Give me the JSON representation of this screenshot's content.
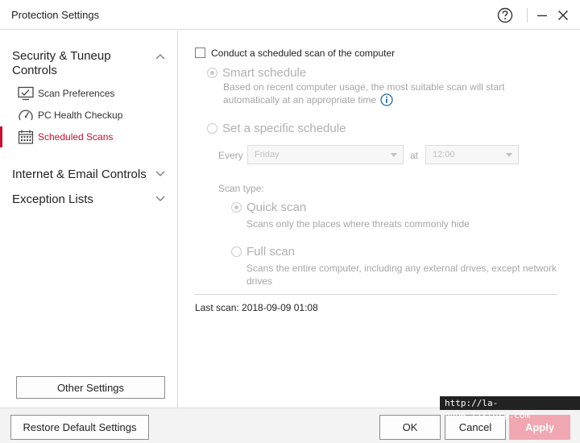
{
  "window": {
    "title": "Protection Settings"
  },
  "sidebar": {
    "sections": [
      {
        "label_line1": "Security & Tuneup",
        "label_line2": "Controls",
        "expanded": true
      },
      {
        "label": "Internet & Email Controls",
        "expanded": false
      },
      {
        "label": "Exception Lists",
        "expanded": false
      }
    ],
    "items": [
      {
        "label": "Scan Preferences",
        "icon": "monitor-check-icon"
      },
      {
        "label": "PC Health Checkup",
        "icon": "gauge-icon"
      },
      {
        "label": "Scheduled Scans",
        "icon": "calendar-icon",
        "active": true
      }
    ],
    "other_settings": "Other Settings"
  },
  "main": {
    "scheduled_scan_checkbox": "Conduct a scheduled scan of the computer",
    "smart_schedule": {
      "title": "Smart schedule",
      "desc_line1": "Based on recent computer usage, the most suitable scan will start",
      "desc_line2": "automatically at an appropriate time"
    },
    "specific_schedule": {
      "title": "Set a specific schedule"
    },
    "every_label": "Every",
    "day_value": "Friday",
    "at_label": "at",
    "time_value": "12:00",
    "scan_type_label": "Scan type:",
    "quick_scan": {
      "title": "Quick scan",
      "desc": "Scans only the places where threats commonly hide"
    },
    "full_scan": {
      "title": "Full scan",
      "desc_line1": "Scans the entire computer, including any external drives, except network",
      "desc_line2": "drives"
    },
    "last_scan": "Last scan: 2018-09-09 01:08"
  },
  "footer": {
    "restore": "Restore Default Settings",
    "ok": "OK",
    "cancel": "Cancel",
    "apply": "Apply"
  },
  "watermark": "http://la-nube.tistory.com",
  "colors": {
    "accent": "#c8102e",
    "apply_disabled": "#f0a7b1",
    "info": "#1e6fa8"
  }
}
